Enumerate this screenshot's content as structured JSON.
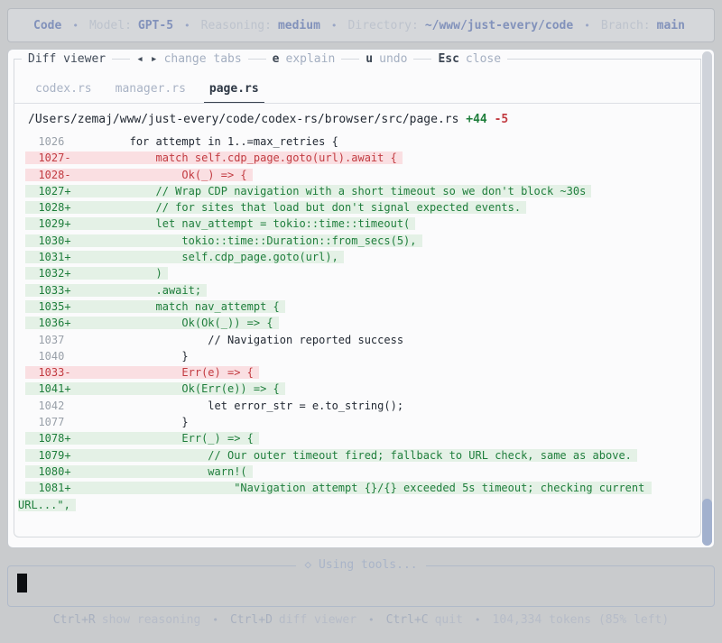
{
  "colors": {
    "page_bg": "#c9cbcd",
    "panel_bg": "#fbfbfc",
    "accent_blue": "#8292bb",
    "added_text": "#1f7e3c",
    "added_bg": "#e4f1e6",
    "removed_text": "#c23b41",
    "removed_bg": "#fadfe2",
    "scrollbar_thumb": "#a2b1ce"
  },
  "header": {
    "app": "Code",
    "sep": "•",
    "model_label": "Model:",
    "model": "GPT-5",
    "reasoning_label": "Reasoning:",
    "reasoning": "medium",
    "directory_label": "Directory:",
    "directory": "~/www/just-every/code",
    "branch_label": "Branch:",
    "branch": "main"
  },
  "diff_viewer": {
    "title": "Diff viewer",
    "arrows": "◂ ▸",
    "change_tabs_label": "change tabs",
    "explain_key": "e",
    "explain_label": "explain",
    "undo_key": "u",
    "undo_label": "undo",
    "close_key": "Esc",
    "close_label": "close",
    "tabs": [
      {
        "label": "codex.rs"
      },
      {
        "label": "manager.rs"
      },
      {
        "label": "page.rs"
      }
    ],
    "file_path": "/Users/zemaj/www/just-every/code/codex-rs/browser/src/page.rs",
    "additions": "+44",
    "deletions": "-5",
    "lines": [
      {
        "prefix": "  1026  ",
        "code": "        for attempt in 1..=max_retries {",
        "type": "context"
      },
      {
        "prefix": "  1027- ",
        "code": "            match self.cdp_page.goto(url).await {",
        "type": "removed"
      },
      {
        "prefix": "  1028- ",
        "code": "                Ok(_) => {",
        "type": "removed"
      },
      {
        "prefix": "  1027+ ",
        "code": "            // Wrap CDP navigation with a short timeout so we don't block ~30s",
        "type": "added"
      },
      {
        "prefix": "  1028+ ",
        "code": "            // for sites that load but don't signal expected events.",
        "type": "added"
      },
      {
        "prefix": "  1029+ ",
        "code": "            let nav_attempt = tokio::time::timeout(",
        "type": "added"
      },
      {
        "prefix": "  1030+ ",
        "code": "                tokio::time::Duration::from_secs(5),",
        "type": "added"
      },
      {
        "prefix": "  1031+ ",
        "code": "                self.cdp_page.goto(url),",
        "type": "added"
      },
      {
        "prefix": "  1032+ ",
        "code": "            )",
        "type": "added"
      },
      {
        "prefix": "  1033+ ",
        "code": "            .await;",
        "type": "added"
      },
      {
        "prefix": "  1035+ ",
        "code": "            match nav_attempt {",
        "type": "added"
      },
      {
        "prefix": "  1036+ ",
        "code": "                Ok(Ok(_)) => {",
        "type": "added"
      },
      {
        "prefix": "  1037  ",
        "code": "                    // Navigation reported success",
        "type": "context"
      },
      {
        "prefix": "  1040  ",
        "code": "                }",
        "type": "context"
      },
      {
        "prefix": "  1033- ",
        "code": "                Err(e) => {",
        "type": "removed"
      },
      {
        "prefix": "  1041+ ",
        "code": "                Ok(Err(e)) => {",
        "type": "added"
      },
      {
        "prefix": "  1042  ",
        "code": "                    let error_str = e.to_string();",
        "type": "context"
      },
      {
        "prefix": "  1077  ",
        "code": "                }",
        "type": "context"
      },
      {
        "prefix": "  1078+ ",
        "code": "                Err(_) => {",
        "type": "added"
      },
      {
        "prefix": "  1079+ ",
        "code": "                    // Our outer timeout fired; fallback to URL check, same as above.",
        "type": "added"
      },
      {
        "prefix": "  1080+ ",
        "code": "                    warn!(",
        "type": "added"
      },
      {
        "prefix": "  1081+ ",
        "code": "                        \"Navigation attempt {}/{} exceeded 5s timeout; checking current URL...\",",
        "type": "added"
      }
    ]
  },
  "status_line": {
    "icon": "◇",
    "text": "Using tools..."
  },
  "footer": {
    "sep": "•",
    "shortcuts": [
      {
        "key": "Ctrl+R",
        "label": "show reasoning"
      },
      {
        "key": "Ctrl+D",
        "label": "diff viewer"
      },
      {
        "key": "Ctrl+C",
        "label": "quit"
      }
    ],
    "tokens": "104,334 tokens (85% left)"
  }
}
